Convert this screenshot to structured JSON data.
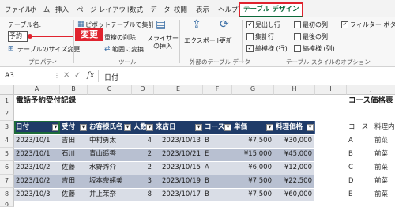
{
  "tabs": [
    "ファイル",
    "ホーム",
    "挿入",
    "ページ レイアウト",
    "数式",
    "データ",
    "校閲",
    "表示",
    "ヘルプ",
    "テーブル デザイン"
  ],
  "ribbon": {
    "table_name_label": "テーブル名:",
    "table_name_value": "予約",
    "callout": "変更",
    "resize_label": "テーブルのサイズ変更",
    "properties_group": "プロパティ",
    "pivot_label": "ピボットテーブルで集計",
    "dup_label": "重複の削除",
    "convert_label": "範囲に変換",
    "slicer_label": "スライサーの挿入",
    "tools_group": "ツール",
    "export_label": "エクスポート",
    "refresh_label": "更新",
    "external_group": "外部のテーブル データ",
    "opt_header": "見出し行",
    "opt_total": "集計行",
    "opt_banded_rows": "縞模様 (行)",
    "opt_first_col": "最初の列",
    "opt_last_col": "最後の列",
    "opt_banded_cols": "縞模様 (列)",
    "opt_filter": "フィルター ボタン",
    "style_group": "テーブル スタイルのオプション"
  },
  "formula": {
    "cell_ref": "A3",
    "fx": "fx",
    "value": "日付"
  },
  "columns": [
    "A",
    "B",
    "C",
    "D",
    "E",
    "F",
    "G",
    "H",
    "I",
    "J"
  ],
  "rows": [
    "1",
    "2",
    "3",
    "4",
    "5",
    "6",
    "7",
    "8",
    "9"
  ],
  "title": "電話予約受付記録",
  "side_title": "コース価格表",
  "headers": [
    "日付",
    "受付",
    "お客様氏名",
    "人数",
    "来店日",
    "コース",
    "単価",
    "料理価格"
  ],
  "data_rows": [
    [
      "2023/10/1",
      "吉田",
      "中村勇太",
      "4",
      "2023/10/13",
      "B",
      "¥7,500",
      "¥30,000"
    ],
    [
      "2023/10/1",
      "石川",
      "青山遥香",
      "2",
      "2023/10/21",
      "E",
      "¥15,000",
      "¥45,000"
    ],
    [
      "2023/10/2",
      "佐藤",
      "水野秀介",
      "2",
      "2023/10/15",
      "A",
      "¥6,000",
      "¥12,000"
    ],
    [
      "2023/10/2",
      "吉田",
      "坂本奈緒美",
      "3",
      "2023/10/19",
      "B",
      "¥7,500",
      "¥22,500"
    ],
    [
      "2023/10/3",
      "佐藤",
      "井上茉奈",
      "8",
      "2023/10/17",
      "B",
      "¥7,500",
      "¥60,000"
    ]
  ],
  "side_header": [
    "コース",
    "料理内"
  ],
  "side_rows": [
    [
      "A",
      "前菜"
    ],
    [
      "B",
      "前菜"
    ],
    [
      "C",
      "前菜"
    ],
    [
      "D",
      "前菜"
    ],
    [
      "E",
      "前菜"
    ]
  ],
  "colors": {
    "accent": "#0b6a3a",
    "header_fill": "#1f3b68",
    "band1": "#d9dde6",
    "band2": "#b8c0d1",
    "callout": "#e0232e"
  }
}
